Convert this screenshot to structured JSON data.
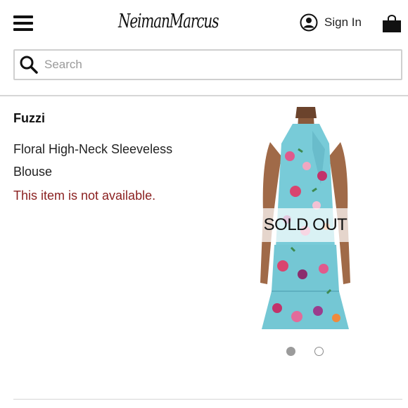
{
  "header": {
    "logo_text": "NeimanMarcus",
    "signin_label": "Sign In",
    "icons": [
      "menu-icon",
      "user-icon",
      "shopping-bag-icon"
    ]
  },
  "search": {
    "placeholder": "Search",
    "icon": "search-icon"
  },
  "product": {
    "brand": "Fuzzi",
    "name": "Floral High-Neck Sleeveless Blouse",
    "availability": "This item is not available.",
    "availability_color": "#8a1f1f",
    "overlay_label": "SOLD OUT",
    "image_count": 2,
    "active_image": 1
  },
  "colors": {
    "print_base": "#6ec9d6",
    "accent_red": "#8a1f1f"
  }
}
